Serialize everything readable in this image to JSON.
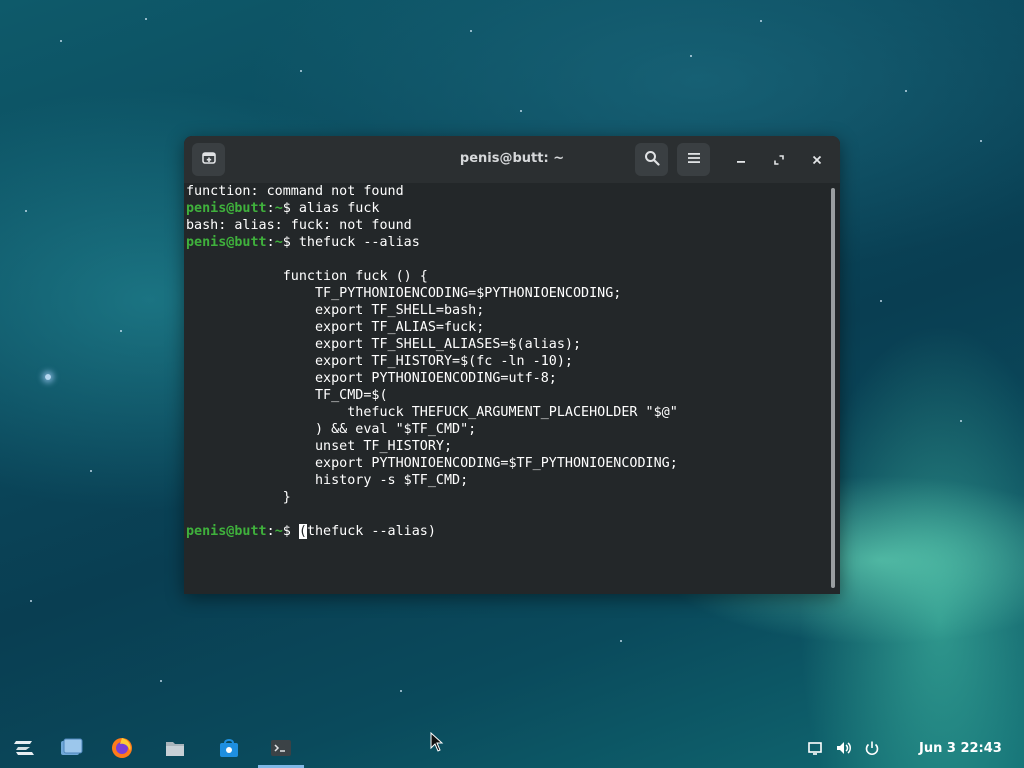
{
  "window": {
    "title": "penis@butt: ~",
    "new_tab_icon": "new-tab-icon",
    "search_icon": "search-icon",
    "menu_icon": "hamburger-menu-icon",
    "minimize_icon": "minimize-icon",
    "maximize_icon": "maximize-icon",
    "close_icon": "close-icon"
  },
  "terminal": {
    "prompt_user": "penis@butt",
    "prompt_sep": ":",
    "prompt_path": "~",
    "prompt_symbol": "$ ",
    "lines": [
      {
        "type": "output",
        "text": "function: command not found"
      },
      {
        "type": "prompt",
        "cmd": "alias fuck"
      },
      {
        "type": "output",
        "text": "bash: alias: fuck: not found"
      },
      {
        "type": "prompt",
        "cmd": "thefuck --alias"
      },
      {
        "type": "output",
        "text": ""
      },
      {
        "type": "output",
        "text": "            function fuck () {"
      },
      {
        "type": "output",
        "text": "                TF_PYTHONIOENCODING=$PYTHONIOENCODING;"
      },
      {
        "type": "output",
        "text": "                export TF_SHELL=bash;"
      },
      {
        "type": "output",
        "text": "                export TF_ALIAS=fuck;"
      },
      {
        "type": "output",
        "text": "                export TF_SHELL_ALIASES=$(alias);"
      },
      {
        "type": "output",
        "text": "                export TF_HISTORY=$(fc -ln -10);"
      },
      {
        "type": "output",
        "text": "                export PYTHONIOENCODING=utf-8;"
      },
      {
        "type": "output",
        "text": "                TF_CMD=$("
      },
      {
        "type": "output",
        "text": "                    thefuck THEFUCK_ARGUMENT_PLACEHOLDER \"$@\""
      },
      {
        "type": "output",
        "text": "                ) && eval \"$TF_CMD\";"
      },
      {
        "type": "output",
        "text": "                unset TF_HISTORY;"
      },
      {
        "type": "output",
        "text": "                export PYTHONIOENCODING=$TF_PYTHONIOENCODING;"
      },
      {
        "type": "output",
        "text": "                history -s $TF_CMD;"
      },
      {
        "type": "output",
        "text": "            }"
      },
      {
        "type": "output",
        "text": ""
      },
      {
        "type": "current",
        "cursor_char": "(",
        "cmd_rest": "thefuck --alias)"
      }
    ]
  },
  "taskbar": {
    "menu_icon": "zorin-menu-icon",
    "apps": [
      {
        "name": "workspaces-icon"
      },
      {
        "name": "firefox-icon"
      },
      {
        "name": "files-icon"
      },
      {
        "name": "software-store-icon"
      },
      {
        "name": "terminal-app-icon",
        "active": true
      }
    ],
    "tray": [
      "screen-icon",
      "volume-icon",
      "power-icon"
    ],
    "clock": "Jun 3  22:43"
  },
  "colors": {
    "prompt_user": "#3fb13c",
    "terminal_bg": "#232729",
    "titlebar_bg": "#2b2f31",
    "active_indicator": "#7fb8e6"
  }
}
